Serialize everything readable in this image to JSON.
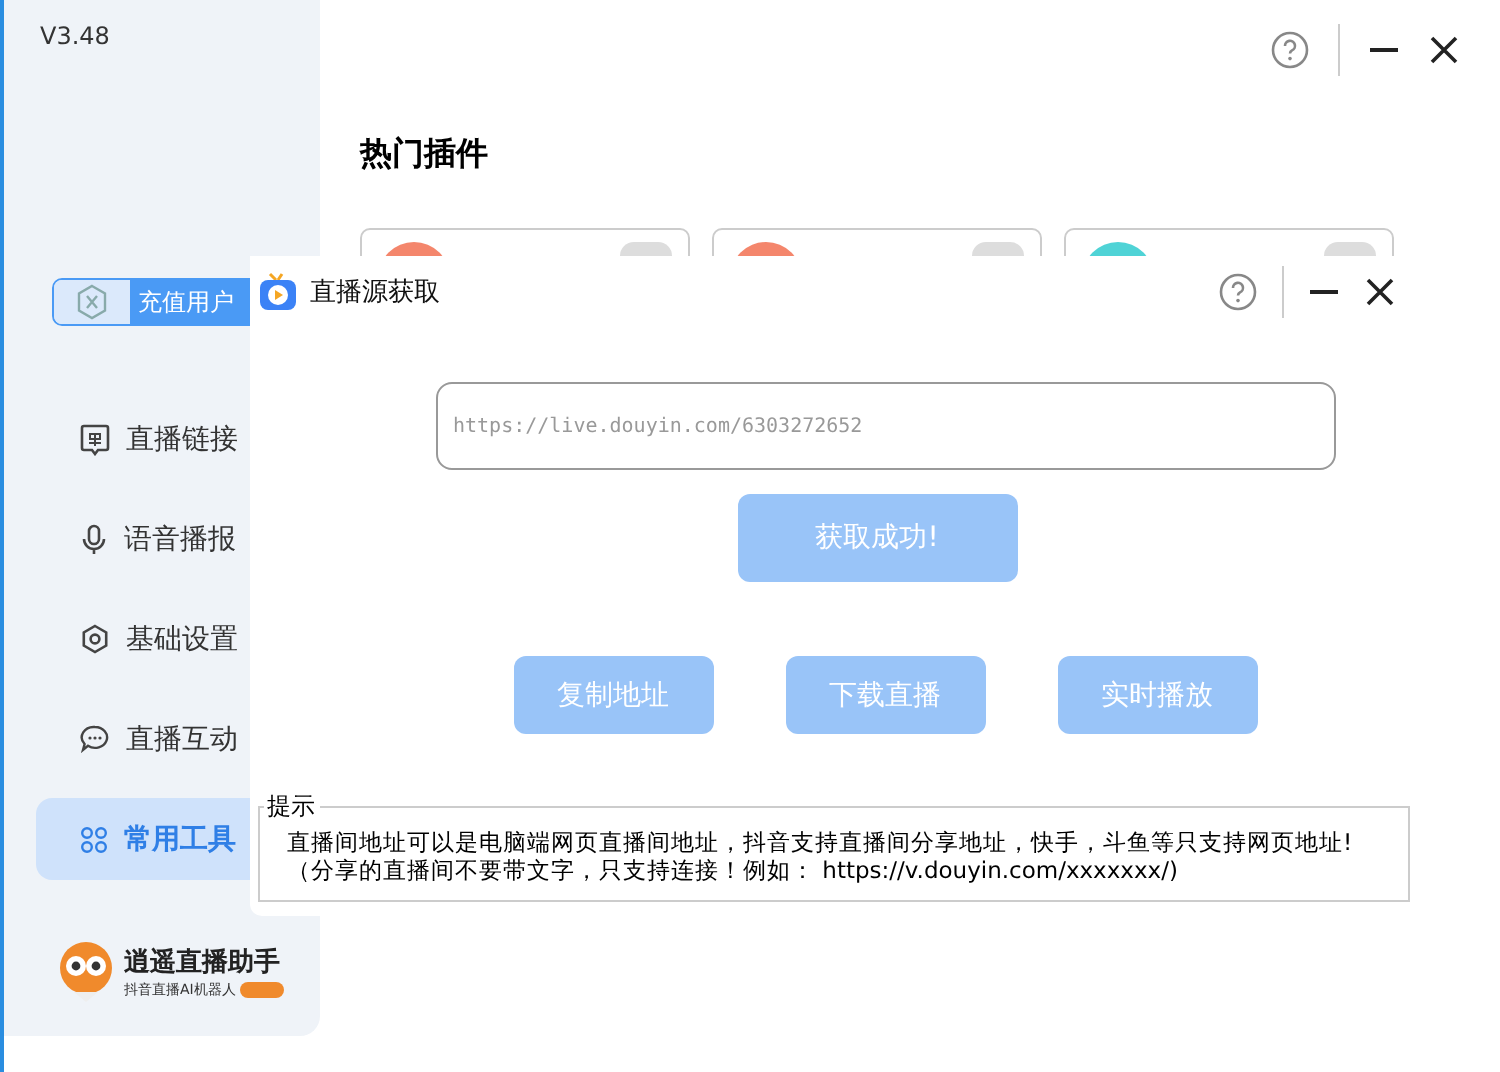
{
  "main_window": {
    "version": "V3.48",
    "section_title": "热门插件",
    "plugins": [
      {
        "color": "#f4866c",
        "on": false
      },
      {
        "color": "#f4866c",
        "on": false
      },
      {
        "color": "#4fd3d6",
        "on": false
      }
    ],
    "vip_badge": "充值用户",
    "sidebar": {
      "items": [
        {
          "label": "直播链接",
          "kind": "danmu",
          "selected": false
        },
        {
          "label": "语音播报",
          "kind": "mic",
          "selected": false
        },
        {
          "label": "基础设置",
          "kind": "settings",
          "selected": false
        },
        {
          "label": "直播互动",
          "kind": "chat",
          "selected": false
        },
        {
          "label": "常用工具",
          "kind": "grid",
          "selected": true
        }
      ]
    },
    "logo": {
      "name": "逍遥直播助手",
      "tagline": "抖音直播AI机器人"
    }
  },
  "dialog": {
    "title": "直播源获取",
    "url_field": {
      "placeholder": "https://live.douyin.com/6303272652"
    },
    "fetch_button": {
      "label": "获取成功!",
      "disabled": true
    },
    "actions": [
      {
        "label": "复制地址",
        "disabled": true
      },
      {
        "label": "下载直播",
        "disabled": true
      },
      {
        "label": "实时播放",
        "disabled": true
      }
    ],
    "hint": {
      "legend": "提示",
      "lines": [
        "直播间地址可以是电脑端网页直播间地址，抖音支持直播间分享地址，快手，斗鱼等只支持网页地址!",
        "（分享的直播间不要带文字，只支持连接！例如： https://v.douyin.com/xxxxxxx/)"
      ]
    }
  }
}
